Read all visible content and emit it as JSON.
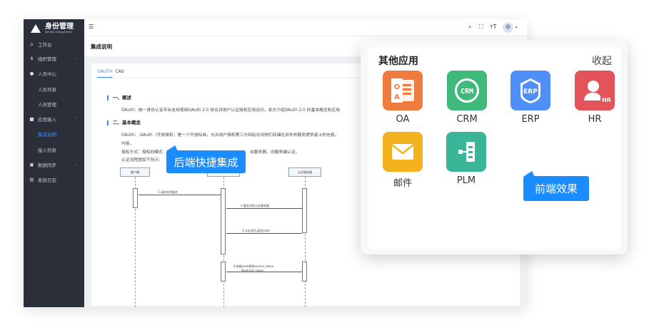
{
  "admin": {
    "brand": {
      "title": "身份管理",
      "subtitle": "Identity management"
    },
    "sidebar": {
      "items": [
        {
          "label": "工作台",
          "icon": "home-icon"
        },
        {
          "label": "组织管理",
          "icon": "org-icon"
        },
        {
          "label": "人员中心",
          "icon": "user-icon"
        },
        {
          "label": "人员列表"
        },
        {
          "label": "人员管理"
        },
        {
          "label": "应用接入",
          "icon": "grid-icon"
        },
        {
          "label": "集成说明"
        },
        {
          "label": "接入列表"
        },
        {
          "label": "数据同步",
          "icon": "sync-icon"
        },
        {
          "label": "系统日志",
          "icon": "log-icon"
        }
      ]
    },
    "page_title": "集成说明",
    "tabs": [
      "OAUTH",
      "CAS"
    ],
    "doc": {
      "section1": "一、概述",
      "p1": "OAuth：统一身份认证平台支持使用OAuth 2.0 协议对用户认证授权应用访问，本文介绍OAuth 2.0 的基本概念和应用",
      "section2": "二、基本概念",
      "p2": "OAuth： OAuth（开放授权）是一个开放标准，允许用户授权第三方网站访问他们存储在另外的服务提供者上的信息，",
      "p3": "内容。",
      "p4a": "授权方式：授权码模式",
      "p4b": "台服务器，向服务端认证。",
      "p5": "认证流程图如下所示："
    },
    "sequence": {
      "actors": [
        "客户端",
        "认证服务器"
      ],
      "messages": [
        "1.请求应用服务",
        "2.重定向到认证服务器",
        "3.认证成功,返回code",
        "4.根据code换取access_token",
        "和refresh_token"
      ]
    }
  },
  "apps_panel": {
    "title": "其他应用",
    "collapse_label": "收起",
    "apps": [
      {
        "label": "OA",
        "icon": "oa-icon",
        "color": "#f07b3f"
      },
      {
        "label": "CRM",
        "icon": "crm-icon",
        "color": "#3fba7b"
      },
      {
        "label": "ERP",
        "icon": "erp-icon",
        "color": "#4f8ff7"
      },
      {
        "label": "HR",
        "icon": "hr-icon",
        "color": "#e25459"
      },
      {
        "label": "邮件",
        "icon": "mail-icon",
        "color": "#f5b21f"
      },
      {
        "label": "PLM",
        "icon": "plm-icon",
        "color": "#39b597"
      }
    ]
  },
  "callouts": {
    "backend": "后端快捷集成",
    "frontend": "前端效果"
  },
  "colors": {
    "accent": "#1a8cff",
    "sidebar": "#2a2f3a"
  }
}
